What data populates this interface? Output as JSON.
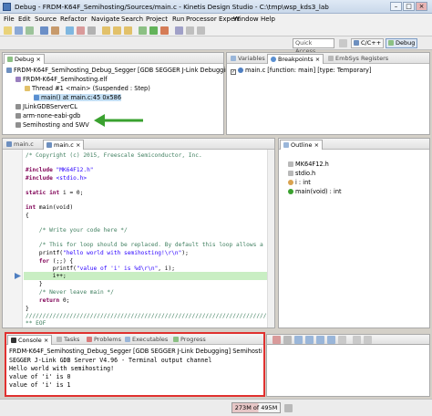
{
  "window": {
    "title": "Debug - FRDM-K64F_Semihosting/Sources/main.c - Kinetis Design Studio - C:\\tmp\\wsp_kds3_lab"
  },
  "menu": [
    "File",
    "Edit",
    "Source",
    "Refactor",
    "Navigate",
    "Search",
    "Project",
    "Run",
    "Processor Expert",
    "Window",
    "Help"
  ],
  "quick_access": "Quick Access",
  "perspectives": [
    "C/C++",
    "Debug"
  ],
  "debug_view": {
    "tab": "Debug",
    "tree": [
      "FRDM-K64F_Semihosting_Debug_Segger [GDB SEGGER J-Link Debugging]",
      "FRDM-K64F_Semihosting.elf",
      "Thread #1 <main> (Suspended : Step)",
      "main() at main.c:45 0x586",
      "JLinkGDBServerCL",
      "arm-none-eabi-gdb",
      "Semihosting and SWV"
    ]
  },
  "breakpoints_view": {
    "tabs": [
      "Variables",
      "Breakpoints",
      "EmbSys Registers"
    ],
    "items": [
      "main.c [function: main] [type: Temporary]"
    ]
  },
  "editor": {
    "tabs": [
      "main.c",
      "main.c"
    ],
    "lines": {
      "l1": "/* Copyright (c) 2015, Freescale Semiconductor, Inc.",
      "l2_kw": "#include",
      "l2_str": " \"MK64F12.h\"",
      "l3_kw": "#include",
      "l3_rest": " <stdio.h>",
      "l4_kw": "static int",
      "l4_rest": " i = 0;",
      "l5_kw": "int",
      "l5_rest": " main(void)",
      "l6": "{",
      "l7": "    /* Write your code here */",
      "l8": "    /* This for loop should be replaced. By default this loop allows a",
      "l9_a": "    printf(",
      "l9_str": "\"hello world with semihosting!\\r\\n\"",
      "l9_b": ");",
      "l10_kw": "    for",
      "l10_rest": " (;;) {",
      "l11_a": "        printf(",
      "l11_str": "\"value of 'i' is %d\\r\\n\"",
      "l11_b": ", i);",
      "l12": "        i++;",
      "l13": "    }",
      "l14": "    /* Never leave main */",
      "l15_kw": "    return",
      "l15_rest": " 0;",
      "l16": "}",
      "l17": "////////////////////////////////////////////////////////////////////////",
      "l18": "** EOF"
    }
  },
  "outline_view": {
    "tab": "Outline",
    "items": [
      "MK64F12.h",
      "stdio.h",
      "i : int",
      "main(void) : int"
    ]
  },
  "console_view": {
    "tabs": [
      "Console",
      "Tasks",
      "Problems",
      "Executables",
      "Progress"
    ],
    "header": "FRDM-K64F_Semihosting_Debug_Segger [GDB SEGGER J-Link Debugging] Semihosting and SWV",
    "lines": [
      "SEGGER J-Link GDB Server V4.96 - Terminal output channel",
      "Hello world with semihosting!",
      "value of 'i' is 0",
      "value of 'i' is 1"
    ]
  },
  "status": {
    "heap": "273M of 495M"
  },
  "colors": {
    "arrow": "#3aa12f",
    "highlight_box": "#e0312f",
    "selection": "#c5e0f5",
    "current_line": "#c9eec3"
  }
}
